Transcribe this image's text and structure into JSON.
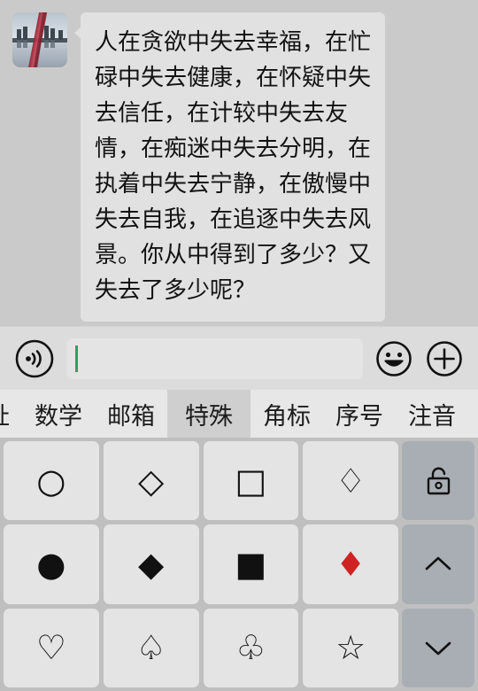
{
  "chat": {
    "avatar_name": "contact-avatar-photo",
    "message_text": "人在贪欲中失去幸福，在忙碌中失去健康，在怀疑中失去信任，在计较中失去友情，在痴迷中失去分明，在执着中失去宁静，在傲慢中失去自我，在追逐中失去风景。你从中得到了多少？又失去了多少呢？",
    "bubble_color": "#e1e1e1",
    "background_color": "#cacaca"
  },
  "input_bar": {
    "voice_icon": "voice-wave-icon",
    "emoji_icon": "emoji-smiley-icon",
    "plus_icon": "plus-circle-icon",
    "input_value": "",
    "input_placeholder": "",
    "caret_color": "#2f9e63"
  },
  "tabs": {
    "items": [
      {
        "label": "址",
        "active": false
      },
      {
        "label": "数学",
        "active": false
      },
      {
        "label": "邮箱",
        "active": false
      },
      {
        "label": "特殊",
        "active": true
      },
      {
        "label": "角标",
        "active": false
      },
      {
        "label": "序号",
        "active": false
      },
      {
        "label": "注音",
        "active": false
      }
    ],
    "active_label": "特殊",
    "active_bg": "#cfcfcf"
  },
  "keyboard": {
    "keys": [
      {
        "symbol": "○",
        "name": "circle-outline",
        "red": false
      },
      {
        "symbol": "◇",
        "name": "diamond-outline",
        "red": false
      },
      {
        "symbol": "□",
        "name": "square-outline",
        "red": false
      },
      {
        "symbol": "♢",
        "name": "card-diamond-outline",
        "red": false
      },
      {
        "symbol": "●",
        "name": "circle-filled",
        "red": false
      },
      {
        "symbol": "◆",
        "name": "diamond-filled",
        "red": false
      },
      {
        "symbol": "■",
        "name": "square-filled",
        "red": false
      },
      {
        "symbol": "♦",
        "name": "card-diamond-red",
        "red": true
      },
      {
        "symbol": "♡",
        "name": "heart-outline",
        "red": false
      },
      {
        "symbol": "♤",
        "name": "spade-outline",
        "red": false
      },
      {
        "symbol": "♧",
        "name": "club-outline",
        "red": false
      },
      {
        "symbol": "☆",
        "name": "star-outline",
        "red": false
      }
    ],
    "side_keys": [
      {
        "name": "unlock-icon"
      },
      {
        "name": "chevron-up-icon"
      },
      {
        "name": "chevron-down-icon"
      }
    ],
    "key_bg": "#e4e4e4",
    "side_key_bg": "#a9adb4",
    "red_color": "#cf2222"
  }
}
